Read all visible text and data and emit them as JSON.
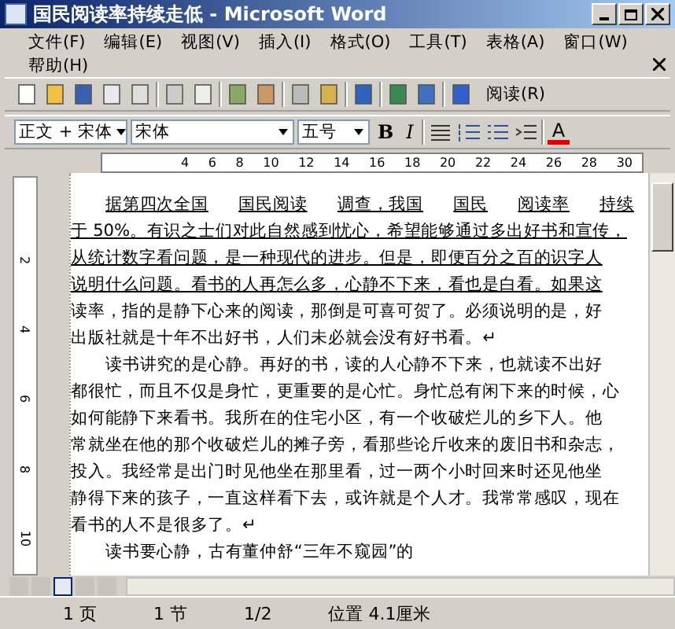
{
  "window": {
    "title": "国民阅读率持续走低 - Microsoft Word"
  },
  "menu": [
    "文件(F)",
    "编辑(E)",
    "视图(V)",
    "插入(I)",
    "格式(O)",
    "工具(T)",
    "表格(A)",
    "窗口(W)",
    "帮助(H)"
  ],
  "toolbar": {
    "read_button": "阅读(R)"
  },
  "format_bar": {
    "style": "正文 + 宋体",
    "font": "宋体",
    "size": "五号",
    "bold": "B",
    "italic": "I",
    "font_color": "A"
  },
  "ruler_ticks": [
    "4",
    "6",
    "8",
    "10",
    "12",
    "14",
    "16",
    "18",
    "20",
    "22",
    "24",
    "26",
    "28",
    "30"
  ],
  "vertical_ruler": [
    "2",
    "4",
    "6",
    "8",
    "10"
  ],
  "lines": [
    {
      "kind": "spread",
      "indent": true,
      "underlined": true,
      "words": [
        "据第四次全国",
        "国民阅读",
        "调查，我国",
        "国民",
        "阅读率",
        "持续"
      ]
    },
    {
      "kind": "text",
      "indent": false,
      "underlined": true,
      "text": "于 50%。有识之士们对此自然感到忧心，希望能够通过多出好书和宣传，"
    },
    {
      "kind": "text",
      "indent": false,
      "underlined": true,
      "text": "从统计数字看问题，是一种现代的进步。但是，即便百分之百的识字人"
    },
    {
      "kind": "text",
      "indent": false,
      "underlined": true,
      "text": "说明什么问题。看书的人再怎么多，心静不下来，看也是白看。如果这"
    },
    {
      "kind": "text",
      "indent": false,
      "underlined": false,
      "text": "读率，指的是静下心来的阅读，那倒是可喜可贺了。必须说明的是，好"
    },
    {
      "kind": "text",
      "indent": false,
      "underlined": false,
      "text": "出版社就是十年不出好书，人们未必就会没有好书看。↵"
    },
    {
      "kind": "text",
      "indent": true,
      "underlined": false,
      "text": "读书讲究的是心静。再好的书，读的人心静不下来，也就读不出好"
    },
    {
      "kind": "text",
      "indent": false,
      "underlined": false,
      "text": "都很忙，而且不仅是身忙，更重要的是心忙。身忙总有闲下来的时候，心"
    },
    {
      "kind": "text",
      "indent": false,
      "underlined": false,
      "text": "如何能静下来看书。我所在的住宅小区，有一个收破烂儿的乡下人。他"
    },
    {
      "kind": "text",
      "indent": false,
      "underlined": false,
      "text": "常就坐在他的那个收破烂儿的摊子旁，看那些论斤收来的废旧书和杂志，"
    },
    {
      "kind": "text",
      "indent": false,
      "underlined": false,
      "text": "投入。我经常是出门时见他坐在那里看，过一两个小时回来时还见他坐"
    },
    {
      "kind": "text",
      "indent": false,
      "underlined": false,
      "text": "静得下来的孩子，一直这样看下去，或许就是个人才。我常常感叹，现在"
    },
    {
      "kind": "text",
      "indent": false,
      "underlined": false,
      "text": "看书的人不是很多了。↵"
    },
    {
      "kind": "text",
      "indent": true,
      "underlined": false,
      "text": "读书要心静，古有董仲舒“三年不窥园”的"
    }
  ],
  "status_bar": [
    "1 页",
    "1 节",
    "1/2",
    "位置 4.1厘米"
  ]
}
